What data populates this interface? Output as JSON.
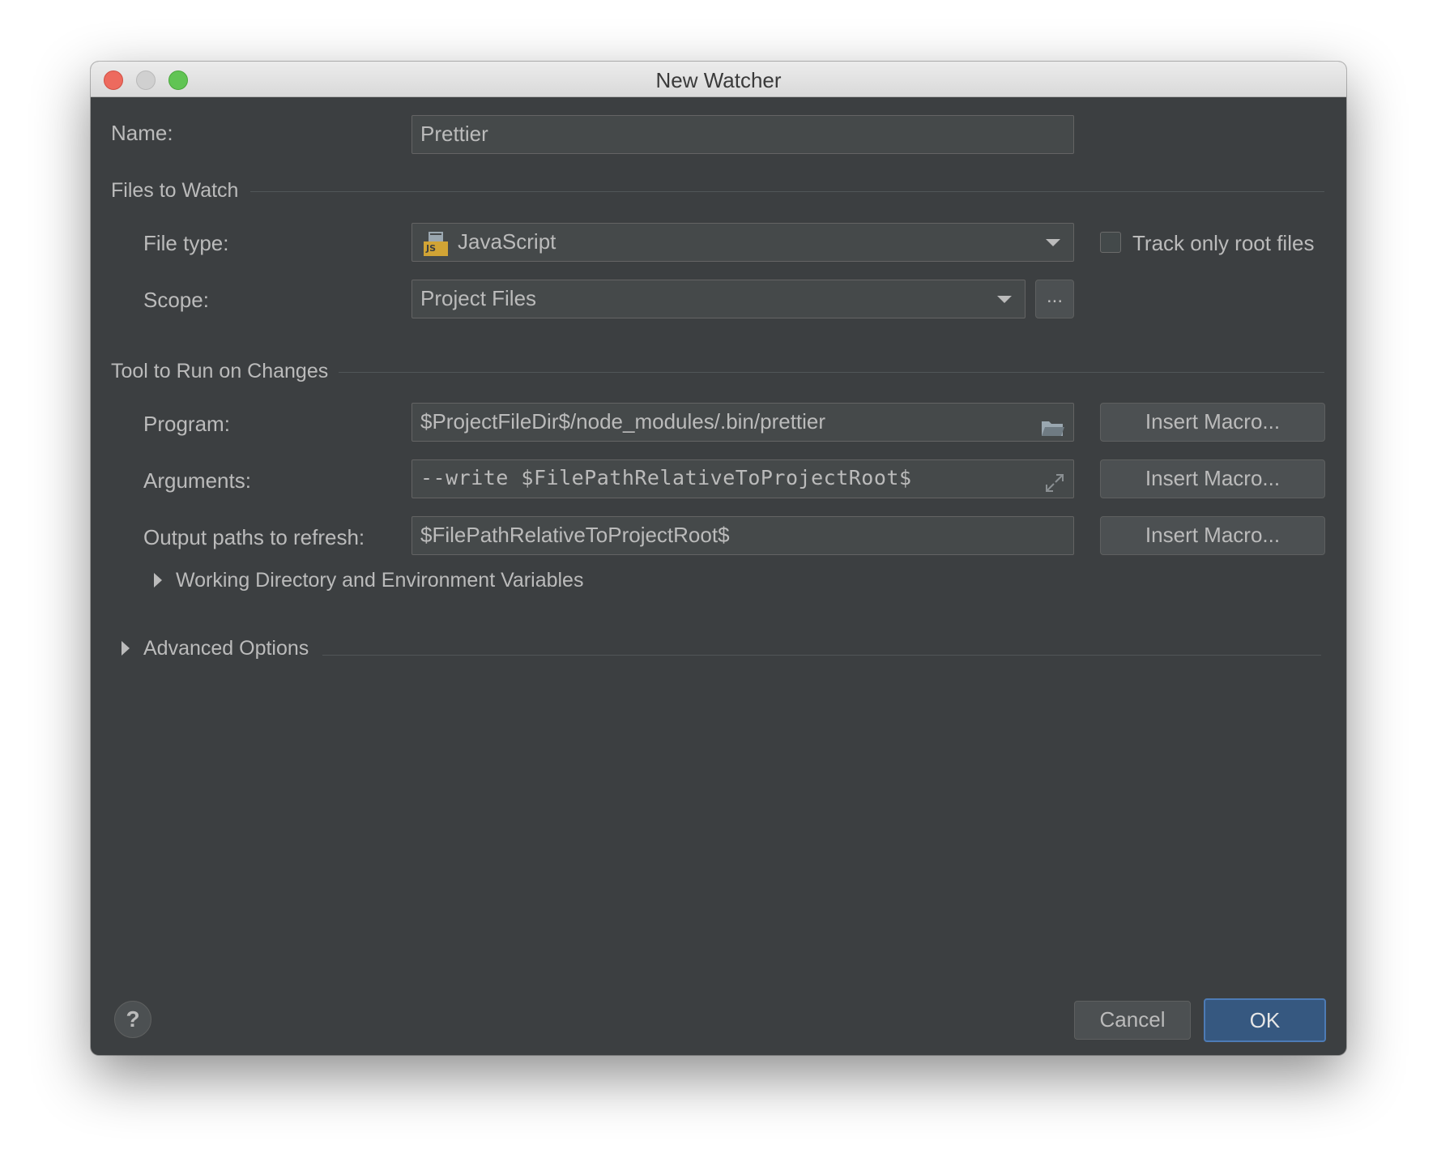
{
  "window": {
    "title": "New Watcher"
  },
  "name": {
    "label": "Name:",
    "value": "Prettier"
  },
  "files_to_watch": {
    "section_title": "Files to Watch",
    "file_type_label": "File type:",
    "file_type_value": "JavaScript",
    "file_type_icon": "javascript-file-icon",
    "file_type_icon_text": "JS",
    "track_root_label": "Track only root files",
    "track_root_checked": false,
    "scope_label": "Scope:",
    "scope_value": "Project Files",
    "scope_more_label": "..."
  },
  "tool": {
    "section_title": "Tool to Run on Changes",
    "program_label": "Program:",
    "program_value": "$ProjectFileDir$/node_modules/.bin/prettier",
    "arguments_label": "Arguments:",
    "arguments_value": "--write $FilePathRelativeToProjectRoot$",
    "output_label": "Output paths to refresh:",
    "output_value": "$FilePathRelativeToProjectRoot$",
    "insert_macro_label": "Insert Macro...",
    "working_dir_label": "Working Directory and Environment Variables"
  },
  "advanced": {
    "label": "Advanced Options"
  },
  "footer": {
    "help_label": "?",
    "cancel_label": "Cancel",
    "ok_label": "OK"
  },
  "colors": {
    "dialog_bg": "#3c3f41",
    "field_bg": "#45494a",
    "text": "#bbbbbb",
    "ok_button": "#365880",
    "js_icon": "#d1a435"
  }
}
